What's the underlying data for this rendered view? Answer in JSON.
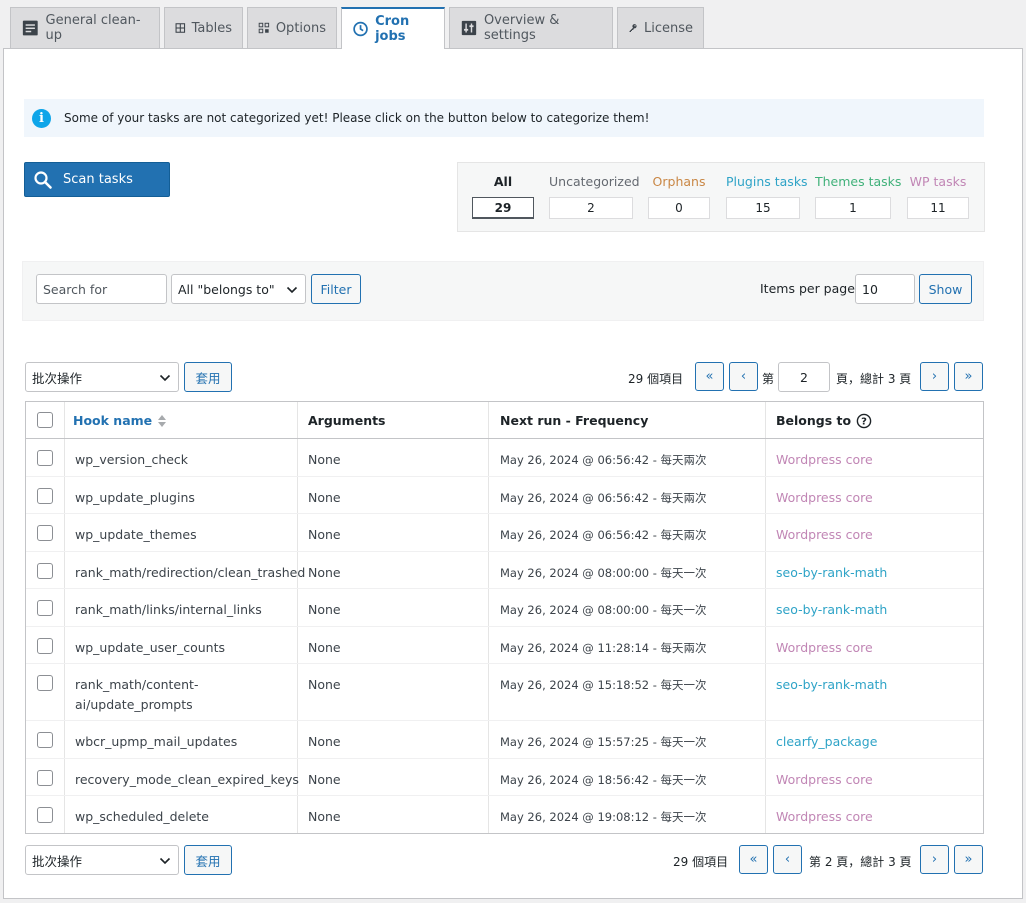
{
  "tabs": [
    {
      "label": "General clean-up",
      "icon": "document-icon"
    },
    {
      "label": "Tables",
      "icon": "grid-icon"
    },
    {
      "label": "Options",
      "icon": "options-icon"
    },
    {
      "label": "Cron jobs",
      "icon": "clock-icon",
      "active": true
    },
    {
      "label": "Overview & settings",
      "icon": "sliders-icon"
    },
    {
      "label": "License",
      "icon": "key-icon"
    }
  ],
  "notice": {
    "text": "Some of your tasks are not categorized yet! Please click on the button below to categorize them!"
  },
  "scan_button": {
    "label": "Scan tasks"
  },
  "filters": [
    {
      "label": "All",
      "count": "29",
      "color": "#1d2327"
    },
    {
      "label": "Uncategorized",
      "count": "2",
      "color": "#646970"
    },
    {
      "label": "Orphans",
      "count": "0",
      "color": "#c98745"
    },
    {
      "label": "Plugins tasks",
      "count": "15",
      "color": "#2ea3c7"
    },
    {
      "label": "Themes tasks",
      "count": "1",
      "color": "#40b17a"
    },
    {
      "label": "WP tasks",
      "count": "11",
      "color": "#c186b5"
    }
  ],
  "search": {
    "placeholder": "Search for",
    "belongs_select": "All \"belongs to\"",
    "filter_button": "Filter",
    "items_per_page_label": "Items per page",
    "items_per_page_value": "10",
    "show_button": "Show"
  },
  "top_nav": {
    "bulk_select": "批次操作",
    "apply_button": "套用",
    "items_count": "29 個項目",
    "first": "«",
    "prev": "‹",
    "page_prefix": "第",
    "current_page": "2",
    "page_suffix": "頁，總計 3 頁",
    "next": "›",
    "last": "»"
  },
  "bottom_nav": {
    "bulk_select": "批次操作",
    "apply_button": "套用",
    "items_count": "29 個項目",
    "first": "«",
    "prev": "‹",
    "page_text": "第 2 頁，總計 3 頁",
    "next": "›",
    "last": "»"
  },
  "table": {
    "headers": {
      "hook": "Hook name",
      "args": "Arguments",
      "next": "Next run - Frequency",
      "belongs": "Belongs to"
    },
    "rows": [
      {
        "hook": "wp_version_check",
        "args": "None",
        "next": "May 26, 2024 @ 06:56:42 - 每天兩次",
        "belongs": "Wordpress core",
        "type": "core"
      },
      {
        "hook": "wp_update_plugins",
        "args": "None",
        "next": "May 26, 2024 @ 06:56:42 - 每天兩次",
        "belongs": "Wordpress core",
        "type": "core"
      },
      {
        "hook": "wp_update_themes",
        "args": "None",
        "next": "May 26, 2024 @ 06:56:42 - 每天兩次",
        "belongs": "Wordpress core",
        "type": "core"
      },
      {
        "hook": "rank_math/redirection/clean_trashed",
        "args": "None",
        "next": "May 26, 2024 @ 08:00:00 - 每天一次",
        "belongs": "seo-by-rank-math",
        "type": "plugin"
      },
      {
        "hook": "rank_math/links/internal_links",
        "args": "None",
        "next": "May 26, 2024 @ 08:00:00 - 每天一次",
        "belongs": "seo-by-rank-math",
        "type": "plugin"
      },
      {
        "hook": "wp_update_user_counts",
        "args": "None",
        "next": "May 26, 2024 @ 11:28:14 - 每天兩次",
        "belongs": "Wordpress core",
        "type": "core"
      },
      {
        "hook": "rank_math/content-ai/update_prompts",
        "args": "None",
        "next": "May 26, 2024 @ 15:18:52 - 每天一次",
        "belongs": "seo-by-rank-math",
        "type": "plugin"
      },
      {
        "hook": "wbcr_upmp_mail_updates",
        "args": "None",
        "next": "May 26, 2024 @ 15:57:25 - 每天一次",
        "belongs": "clearfy_package",
        "type": "plugin"
      },
      {
        "hook": "recovery_mode_clean_expired_keys",
        "args": "None",
        "next": "May 26, 2024 @ 18:56:42 - 每天一次",
        "belongs": "Wordpress core",
        "type": "core"
      },
      {
        "hook": "wp_scheduled_delete",
        "args": "None",
        "next": "May 26, 2024 @ 19:08:12 - 每天一次",
        "belongs": "Wordpress core",
        "type": "core"
      }
    ]
  }
}
